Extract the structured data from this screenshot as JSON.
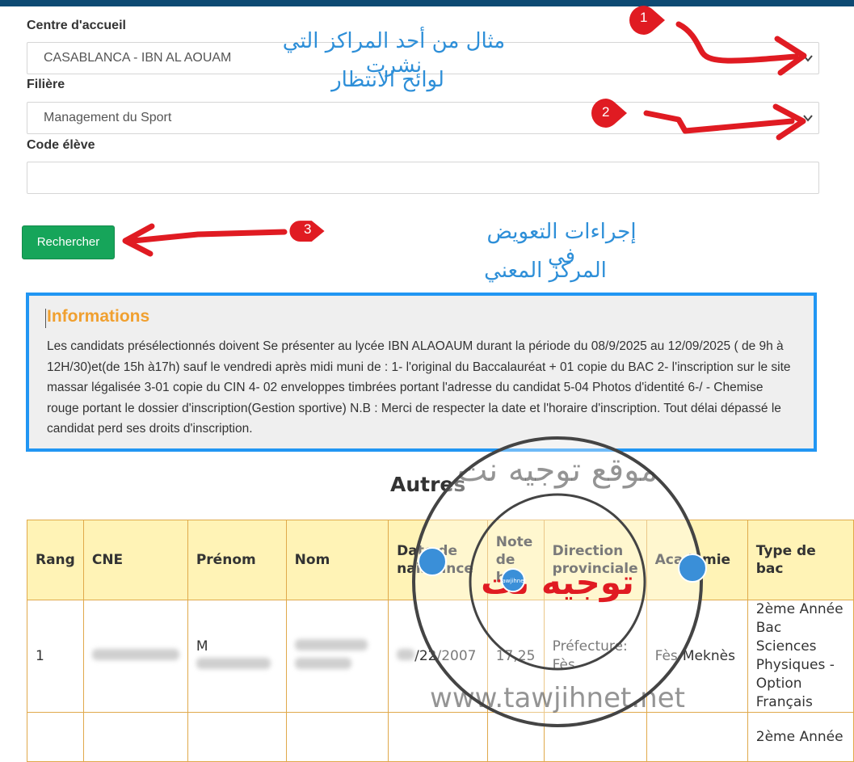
{
  "form": {
    "centre_label": "Centre d'accueil",
    "centre_value": "CASABLANCA - IBN AL AOUAM",
    "filiere_label": "Filière",
    "filiere_value": "Management du Sport",
    "code_label": "Code élève",
    "code_value": "",
    "search_button": "Rechercher"
  },
  "info": {
    "title": "Informations",
    "text": "Les candidats présélectionnés doivent Se présenter au lycée IBN ALAOAUM durant la période du 08/9/2025 au 12/09/2025 ( de 9h à 12H/30)et(de 15h à17h) sauf le vendredi après midi muni de : 1- l'original du Baccalauréat + 01 copie du BAC 2- l'inscription sur le site massar légalisée 3-01 copie du CIN 4- 02 enveloppes timbrées portant l'adresse du candidat 5-04 Photos d'identité 6-/ - Chemise rouge portant le dossier d'inscription(Gestion sportive) N.B : Merci de respecter la date et l'horaire d'inscription. Tout délai dépassé le candidat perd ses droits d'inscription."
  },
  "section_title": "Autres",
  "table": {
    "headers": {
      "rang": "Rang",
      "cne": "CNE",
      "prenom": "Prénom",
      "nom": "Nom",
      "date": "Date de naissance",
      "note": "Note de bac",
      "direction": "Direction provinciale",
      "academie": "Académie",
      "type": "Type de bac"
    },
    "rows": [
      {
        "rang": "1",
        "prenom_partial": "M",
        "date_partial": "/22/2007",
        "note": "17,25",
        "direction": "Préfecture: Fès",
        "academie": "Fès-Meknès",
        "type": "2ème Année Bac Sciences Physiques - Option Français"
      },
      {
        "type_partial": "2ème Année"
      }
    ]
  },
  "annotations": {
    "arabic_1": "مثال من أحد المراكز التي نشرت",
    "arabic_2": "لوائح الانتظار",
    "arabic_3": "إجراءات التعويض في",
    "arabic_4": "المركز المعني",
    "badge_1": "1",
    "badge_2": "2",
    "badge_3": "3"
  },
  "watermark": {
    "arabic": "موقع توجيه نت",
    "url": "www.tawjihnet.net",
    "logo_text": "توجيه نت",
    "logo_small": "tawjihnet"
  },
  "colors": {
    "accent_blue": "#2196f3",
    "button_green": "#16a55a",
    "info_title": "#f0a030",
    "header_yellow": "#fff3b6",
    "table_border": "#e0a94b",
    "annotation_red": "#e01b22"
  }
}
